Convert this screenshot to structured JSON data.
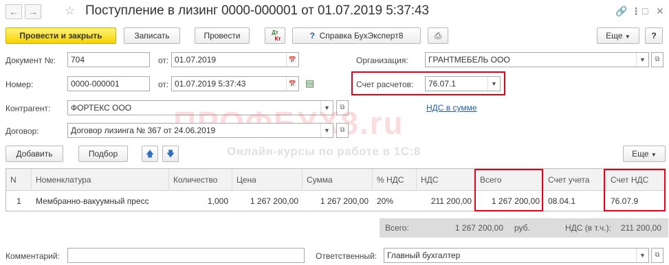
{
  "window": {
    "title": "Поступление в лизинг 0000-000001 от 01.07.2019 5:37:43",
    "back_icon": "arrow-left-icon",
    "forward_icon": "arrow-right-icon",
    "link_icon": "link-icon",
    "menu_icon": "more-vertical-icon",
    "maximize_icon": "maximize-icon",
    "close_icon": "close-icon"
  },
  "toolbar": {
    "post_close_label": "Провести и закрыть",
    "save_label": "Записать",
    "post_label": "Провести",
    "dtkt_label_top": "Дт",
    "dtkt_label_bottom": "Кт",
    "help_label": "Справка БухЭксперт8",
    "more_label": "Еще"
  },
  "form": {
    "doc_label": "Документ №:",
    "doc_value": "704",
    "doc_date_label": "от:",
    "doc_date_value": "01.07.2019",
    "org_label": "Организация:",
    "org_value": "ГРАНТМЕБЕЛЬ ООО",
    "num_label": "Номер:",
    "num_value": "0000-000001",
    "num_date_label": "от:",
    "num_date_value": "01.07.2019  5:37:43",
    "account_label": "Счет расчетов:",
    "account_value": "76.07.1",
    "contractor_label": "Контрагент:",
    "contractor_value": "ФОРТЕКС ООО",
    "vat_link": "НДС в сумме",
    "contract_label": "Договор:",
    "contract_value": "Договор лизинга № 367 от 24.06.2019",
    "comment_label": "Комментарий:",
    "comment_value": "",
    "responsible_label": "Ответственный:",
    "responsible_value": "Главный бухгалтер"
  },
  "watermark": {
    "line1": "ПРОФБУХ8.ru",
    "line2": "Онлайн-курсы по работе в 1С:8"
  },
  "table_toolbar": {
    "add_label": "Добавить",
    "select_label": "Подбор",
    "more_label": "Еще"
  },
  "table": {
    "columns": [
      "N",
      "Номенклатура",
      "Количество",
      "Цена",
      "Сумма",
      "% НДС",
      "НДС",
      "Всего",
      "Счет учета",
      "Счет НДС"
    ],
    "rows": [
      [
        "1",
        "Мембранно-вакуумный пресс",
        "1,000",
        "1 267 200,00",
        "1 267 200,00",
        "20%",
        "211 200,00",
        "1 267 200,00",
        "08.04.1",
        "76.07.9"
      ]
    ]
  },
  "totals": {
    "total_label": "Всего:",
    "total_value": "1 267 200,00",
    "currency": "руб.",
    "vat_label": "НДС (в т.ч.):",
    "vat_value": "211 200,00"
  },
  "colors": {
    "primary_button": "#f5d300",
    "highlight_border": "#e0001a",
    "link": "#1c5fa8"
  }
}
